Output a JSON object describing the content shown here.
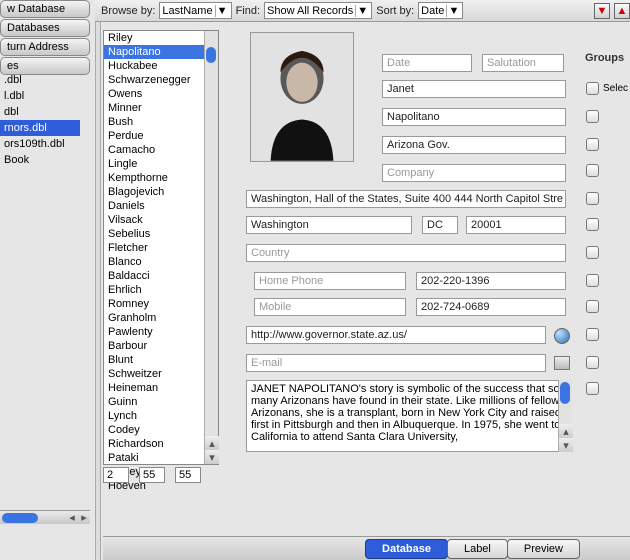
{
  "left_panels": [
    "w Database",
    "Databases",
    "turn Address",
    "es"
  ],
  "files": [
    {
      "name": ".dbl",
      "sel": false
    },
    {
      "name": "l.dbl",
      "sel": false
    },
    {
      "name": "dbl",
      "sel": false
    },
    {
      "name": "rnors.dbl",
      "sel": true
    },
    {
      "name": "ors109th.dbl",
      "sel": false
    },
    {
      "name": "Book",
      "sel": false
    }
  ],
  "topbar": {
    "browse_label": "Browse by:",
    "browse_value": "LastName",
    "find_label": "Find:",
    "find_value": "Show All Records",
    "sort_label": "Sort by:",
    "sort_value": "Date"
  },
  "names": [
    "Riley",
    "Napolitano",
    "Huckabee",
    "Schwarzenegger",
    "Owens",
    "Minner",
    "Bush",
    "Perdue",
    "Camacho",
    "Lingle",
    "Kempthorne",
    "Blagojevich",
    "Daniels",
    "Vilsack",
    "Sebelius",
    "Fletcher",
    "Blanco",
    "Baldacci",
    "Ehrlich",
    "Romney",
    "Granholm",
    "Pawlenty",
    "Barbour",
    "Blunt",
    "Schweitzer",
    "Heineman",
    "Guinn",
    "Lynch",
    "Codey",
    "Richardson",
    "Pataki",
    "Easley",
    "Hoeven"
  ],
  "selected_name_index": 1,
  "counters": {
    "a": "2",
    "b": "55",
    "c": "55"
  },
  "form": {
    "date_ph": "Date",
    "salutation_ph": "Salutation",
    "first": "Janet",
    "last": "Napolitano",
    "org": "Arizona Gov.",
    "company_ph": "Company",
    "street": "Washington, Hall of the States, Suite 400 444 North Capitol Stre",
    "city": "Washington",
    "state": "DC",
    "zip": "20001",
    "country_ph": "Country",
    "homephone_ph": "Home Phone",
    "fax": "202-220-1396",
    "mobile_ph": "Mobile",
    "phone2": "202-724-0689",
    "url": "http://www.governor.state.az.us/",
    "email_ph": "E-mail",
    "notes": "JANET NAPOLITANO's story is symbolic of the success that so many Arizonans have found in their state. Like millions of fellow Arizonans, she is a transplant, born in New York City and raised first in Pittsburgh and then in Albuquerque. In 1975, she went to California to attend Santa Clara University,"
  },
  "groups_label": "Groups",
  "select_label": "Selec",
  "footer": {
    "tabs": [
      {
        "label": "Database",
        "active": true
      },
      {
        "label": "Label",
        "active": false
      },
      {
        "label": "Preview",
        "active": false
      }
    ]
  }
}
